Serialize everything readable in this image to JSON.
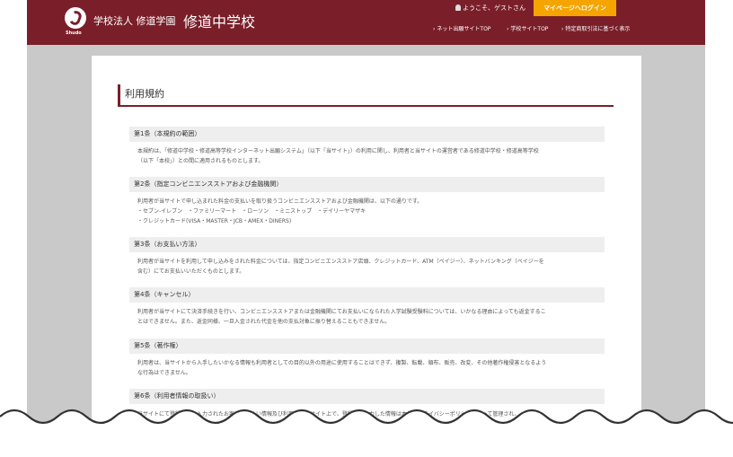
{
  "header": {
    "logo_caption": "Shudo",
    "school_type": "学校法人 修道学園",
    "school_name": "修道中学校",
    "greeting": "ようこそ、ゲストさん",
    "login_label": "マイページへログイン",
    "nav": [
      {
        "label": "ネット出願サイトTOP"
      },
      {
        "label": "学校サイトTOP"
      },
      {
        "label": "特定商取引法に基づく表示"
      }
    ]
  },
  "page": {
    "title": "利用規約",
    "articles": [
      {
        "heading": "第1条（本規約の範囲）",
        "lines": [
          "本規約は、「修道中学校・修道高等学校インターネット出願システム」（以下「当サイト」）の利用に関し、利用者と当サイトの運営者である修道中学校・修道高等学校",
          "（以下「本校」）との間に適用されるものとします。"
        ]
      },
      {
        "heading": "第2条（指定コンビニエンスストアおよび金融機関）",
        "lines": [
          "利用者が当サイトで申し込まれた料金の支払いを取り扱うコンビニエンスストアおよび金融機関は、以下の通りです。",
          "・セブン-イレブン　・ファミリーマート　・ローソン　・ミニストップ　・デイリーヤマザキ",
          "・クレジットカード(VISA・MASTER・JCB・AMEX・DINERS)"
        ]
      },
      {
        "heading": "第3条（お支払い方法）",
        "lines": [
          "利用者が当サイトを利用して申し込みをされた料金については、指定コンビニエンスストア店頭、クレジットカード、ATM（ペイジー）、ネットバンキング（ペイジーを",
          "含む）にてお支払いいただくものとします。"
        ]
      },
      {
        "heading": "第4条（キャンセル）",
        "lines": [
          "利用者が当サイトにて決済手続きを行い、コンビニエンスストアまたは金融機関にてお支払いになられた入学試験受験料については、いかなる理由によっても返金するこ",
          "とはできません。また、返金同様、一旦入金された代金を他の支払対象に振り替えることもできません。"
        ]
      },
      {
        "heading": "第5条（著作権）",
        "lines": [
          "利用者は、当サイトから入手したいかなる情報も利用者としての目的以外の用途に使用することはできず、複製、転載、頒布、販売、改変、その他著作権侵害となるよう",
          "な行為はできません。"
        ]
      },
      {
        "heading": "第6条（利用者情報の取扱い）",
        "lines": [
          "当サイトにて登録され、入力されたお客様の支払い情報及び利用者が当サイト上で、登録時に入力した情報は本校のプライバシーポリシーに従って管理され、"
        ]
      }
    ]
  },
  "colors": {
    "brand": "#7a1f2a",
    "accent": "#f5a400",
    "backdrop": "#c9c9c9"
  }
}
